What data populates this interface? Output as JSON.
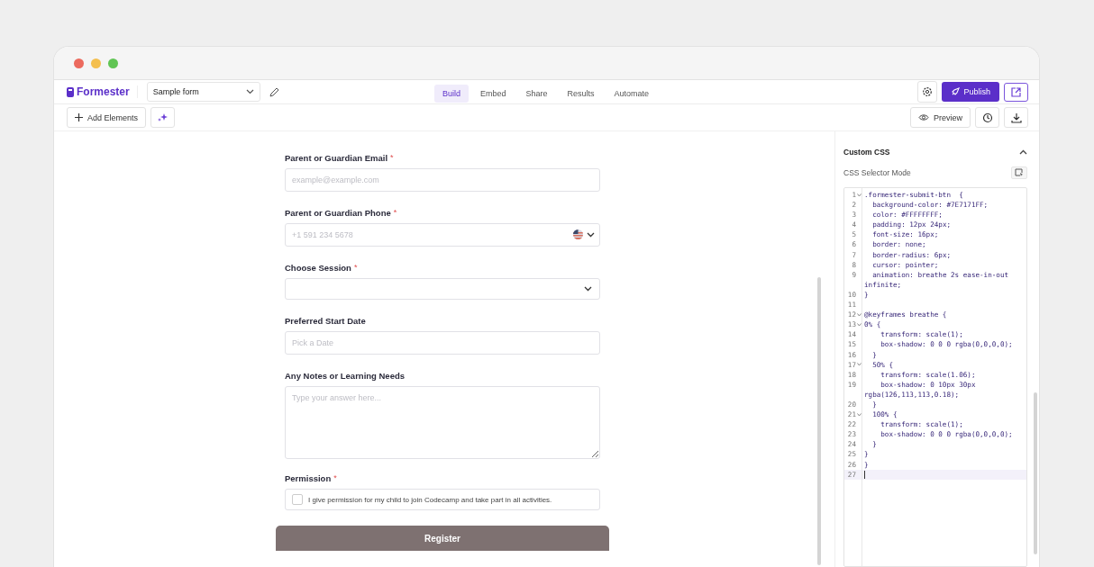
{
  "app": {
    "logo": "Formester",
    "form_name": "Sample form"
  },
  "tabs": [
    {
      "label": "Build",
      "selected": true
    },
    {
      "label": "Embed",
      "selected": false
    },
    {
      "label": "Share",
      "selected": false
    },
    {
      "label": "Results",
      "selected": false
    },
    {
      "label": "Automate",
      "selected": false
    }
  ],
  "actions": {
    "publish": "Publish",
    "add_elements": "Add Elements",
    "preview": "Preview"
  },
  "form": {
    "fields": [
      {
        "kind": "email",
        "label": "Parent or Guardian Email",
        "required_mark": "*",
        "placeholder": "example@example.com"
      },
      {
        "kind": "phone",
        "label": "Parent or Guardian Phone",
        "required_mark": "*",
        "placeholder": "+1 591 234 5678"
      },
      {
        "kind": "select",
        "label": "Choose Session",
        "required_mark": "*"
      },
      {
        "kind": "date",
        "label": "Preferred Start Date",
        "placeholder": "Pick a Date"
      },
      {
        "kind": "textarea",
        "label": "Any Notes or Learning Needs",
        "placeholder": "Type your answer here..."
      },
      {
        "kind": "checkbox",
        "label": "Permission",
        "required_mark": "*",
        "option": "I give permission for my child to join Codecamp and take part in all activities.",
        "checked": false
      }
    ],
    "submit": "Register"
  },
  "panel": {
    "title": "Custom CSS",
    "expanded": true,
    "mode_label": "CSS Selector Mode",
    "code": [
      {
        "number": "1",
        "foldable": true,
        "text": ".formester-submit-btn  {"
      },
      {
        "number": "2",
        "foldable": false,
        "text": "  background-color: #7E7171FF;"
      },
      {
        "number": "3",
        "foldable": false,
        "text": "  color: #FFFFFFFF;"
      },
      {
        "number": "4",
        "foldable": false,
        "text": "  padding: 12px 24px;"
      },
      {
        "number": "5",
        "foldable": false,
        "text": "  font-size: 16px;"
      },
      {
        "number": "6",
        "foldable": false,
        "text": "  border: none;"
      },
      {
        "number": "7",
        "foldable": false,
        "text": "  border-radius: 6px;"
      },
      {
        "number": "8",
        "foldable": false,
        "text": "  cursor: pointer;"
      },
      {
        "number": "9",
        "foldable": false,
        "text": "  animation: breathe 2s ease-in-out infinite;"
      },
      {
        "number": "10",
        "foldable": false,
        "text": "}"
      },
      {
        "number": "11",
        "foldable": false
      },
      {
        "number": "12",
        "foldable": true,
        "text": "@keyframes breathe {"
      },
      {
        "number": "13",
        "foldable": true,
        "text": "0% {"
      },
      {
        "number": "14",
        "foldable": false,
        "text": "    transform: scale(1);"
      },
      {
        "number": "15",
        "foldable": false,
        "text": "    box-shadow: 0 0 0 rgba(0,0,0,0);"
      },
      {
        "number": "16",
        "foldable": false,
        "text": "  }"
      },
      {
        "number": "17",
        "foldable": true,
        "text": "  50% {"
      },
      {
        "number": "18",
        "foldable": false,
        "text": "    transform: scale(1.06);"
      },
      {
        "number": "19",
        "foldable": false,
        "text": "    box-shadow: 0 10px 30px rgba(126,113,113,0.18);"
      },
      {
        "number": "20",
        "foldable": false,
        "text": "  }"
      },
      {
        "number": "21",
        "foldable": true,
        "text": "  100% {"
      },
      {
        "number": "22",
        "foldable": false,
        "text": "    transform: scale(1);"
      },
      {
        "number": "23",
        "foldable": false,
        "text": "    box-shadow: 0 0 0 rgba(0,0,0,0);"
      },
      {
        "number": "24",
        "foldable": false,
        "text": "  }"
      },
      {
        "number": "25",
        "foldable": false,
        "text": "}"
      },
      {
        "number": "26",
        "foldable": false,
        "text": "}"
      },
      {
        "number": "27",
        "foldable": false,
        "current": true
      }
    ]
  }
}
